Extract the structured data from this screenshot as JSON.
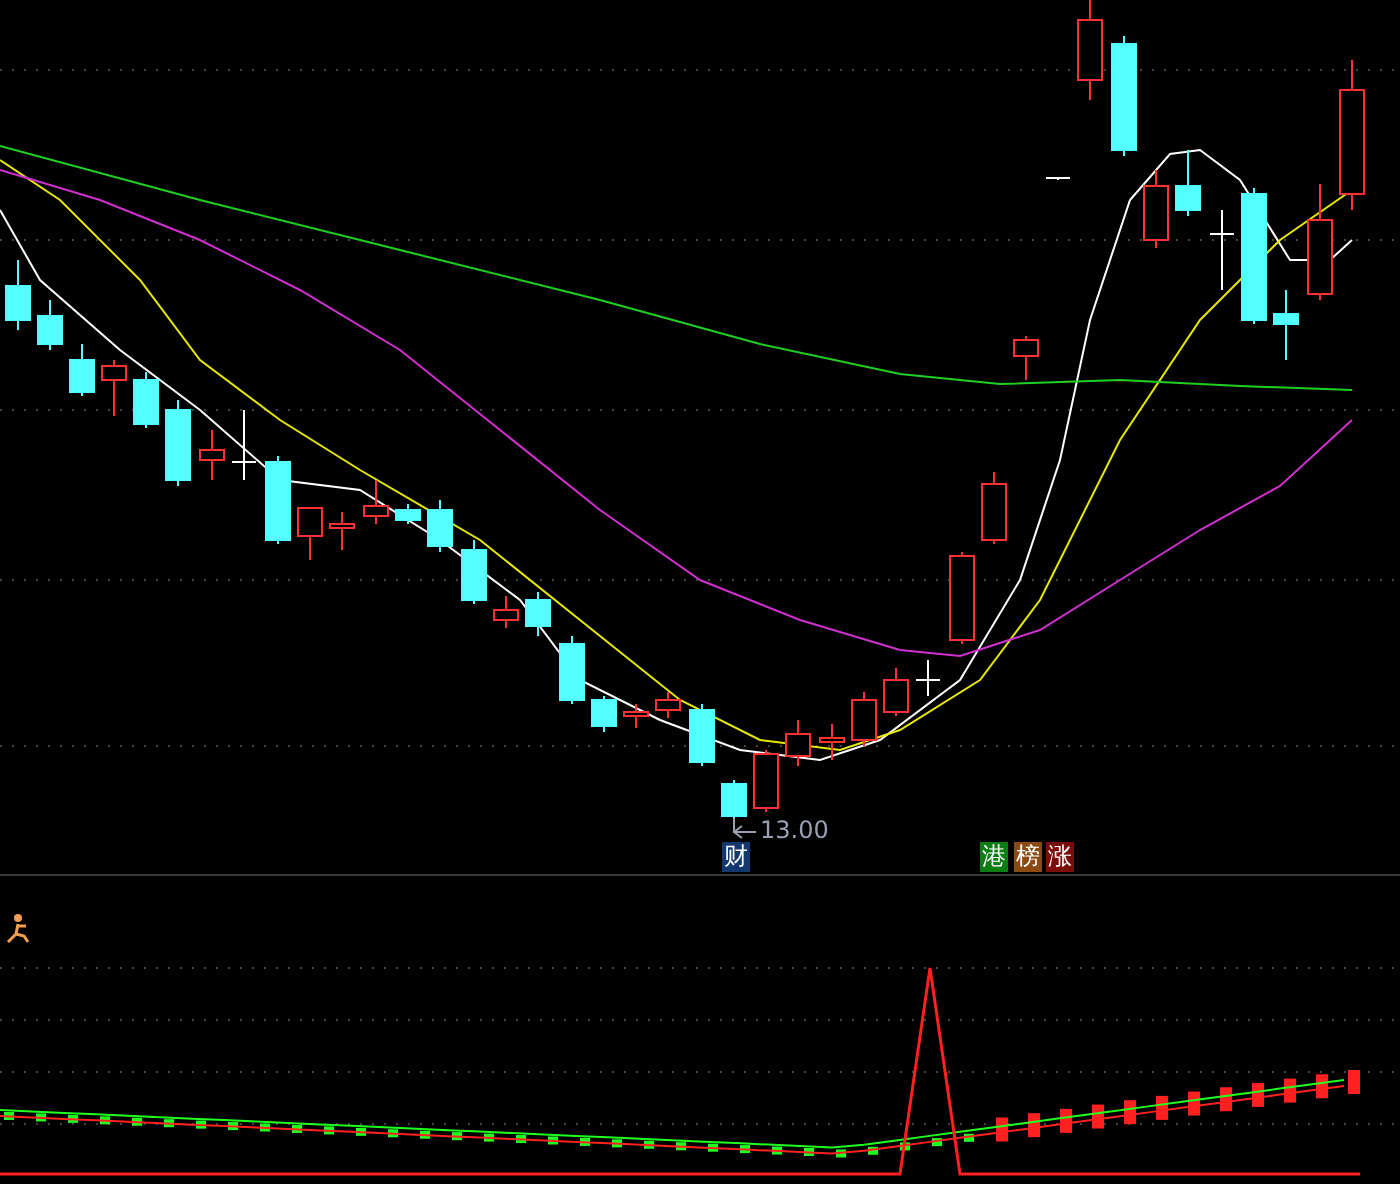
{
  "price_panel": {
    "low_price_label": "13.00",
    "left_markers": [
      {
        "text": "财",
        "color": "#12386e"
      }
    ],
    "right_markers": [
      {
        "text": "港",
        "color": "#0b7d12"
      },
      {
        "text": "榜",
        "color": "#8a4a12"
      },
      {
        "text": "涨",
        "color": "#7a0c0c"
      }
    ]
  }
}
